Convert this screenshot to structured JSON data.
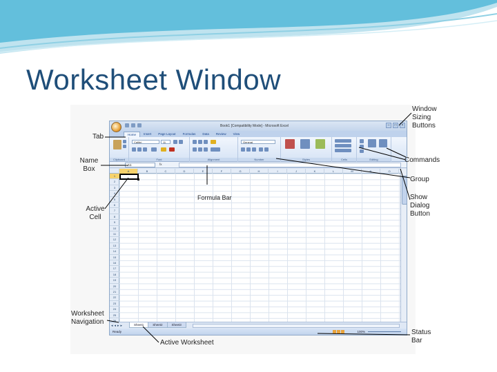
{
  "slide": {
    "title": "Worksheet Window"
  },
  "callouts": {
    "tab": "Tab",
    "name_box": "Name Box",
    "active_cell": "Active Cell",
    "worksheet_navigation": "Worksheet Navigation",
    "active_worksheet": "Active Worksheet",
    "formula_bar": "Formula Bar",
    "window_sizing_buttons": "Window Sizing Buttons",
    "commands": "Commands",
    "group": "Group",
    "show_dialog_button": "Show Dialog Button",
    "status_bar": "Status Bar"
  },
  "excel": {
    "window_title": "Book1 [Compatibility Mode] - Microsoft Excel",
    "tabs": [
      "Home",
      "Insert",
      "Page Layout",
      "Formulas",
      "Data",
      "Review",
      "View"
    ],
    "groups": [
      "Clipboard",
      "Font",
      "Alignment",
      "Number",
      "Styles",
      "Cells",
      "Editing"
    ],
    "font_name": "Calibri",
    "font_size": "11",
    "number_format": "General",
    "name_box": "A1",
    "fx": "fx",
    "columns": [
      "A",
      "B",
      "C",
      "D",
      "E",
      "F",
      "G",
      "H",
      "I",
      "J",
      "K",
      "L",
      "M",
      "N",
      "O"
    ],
    "rows": [
      "1",
      "2",
      "3",
      "4",
      "5",
      "6",
      "7",
      "8",
      "9",
      "10",
      "11",
      "12",
      "13",
      "14",
      "15",
      "16",
      "17",
      "18",
      "19",
      "20",
      "21",
      "22",
      "23",
      "24",
      "25",
      "26"
    ],
    "sheets": [
      "Sheet1",
      "Sheet2",
      "Sheet3"
    ],
    "status": "Ready",
    "zoom": "100%"
  }
}
